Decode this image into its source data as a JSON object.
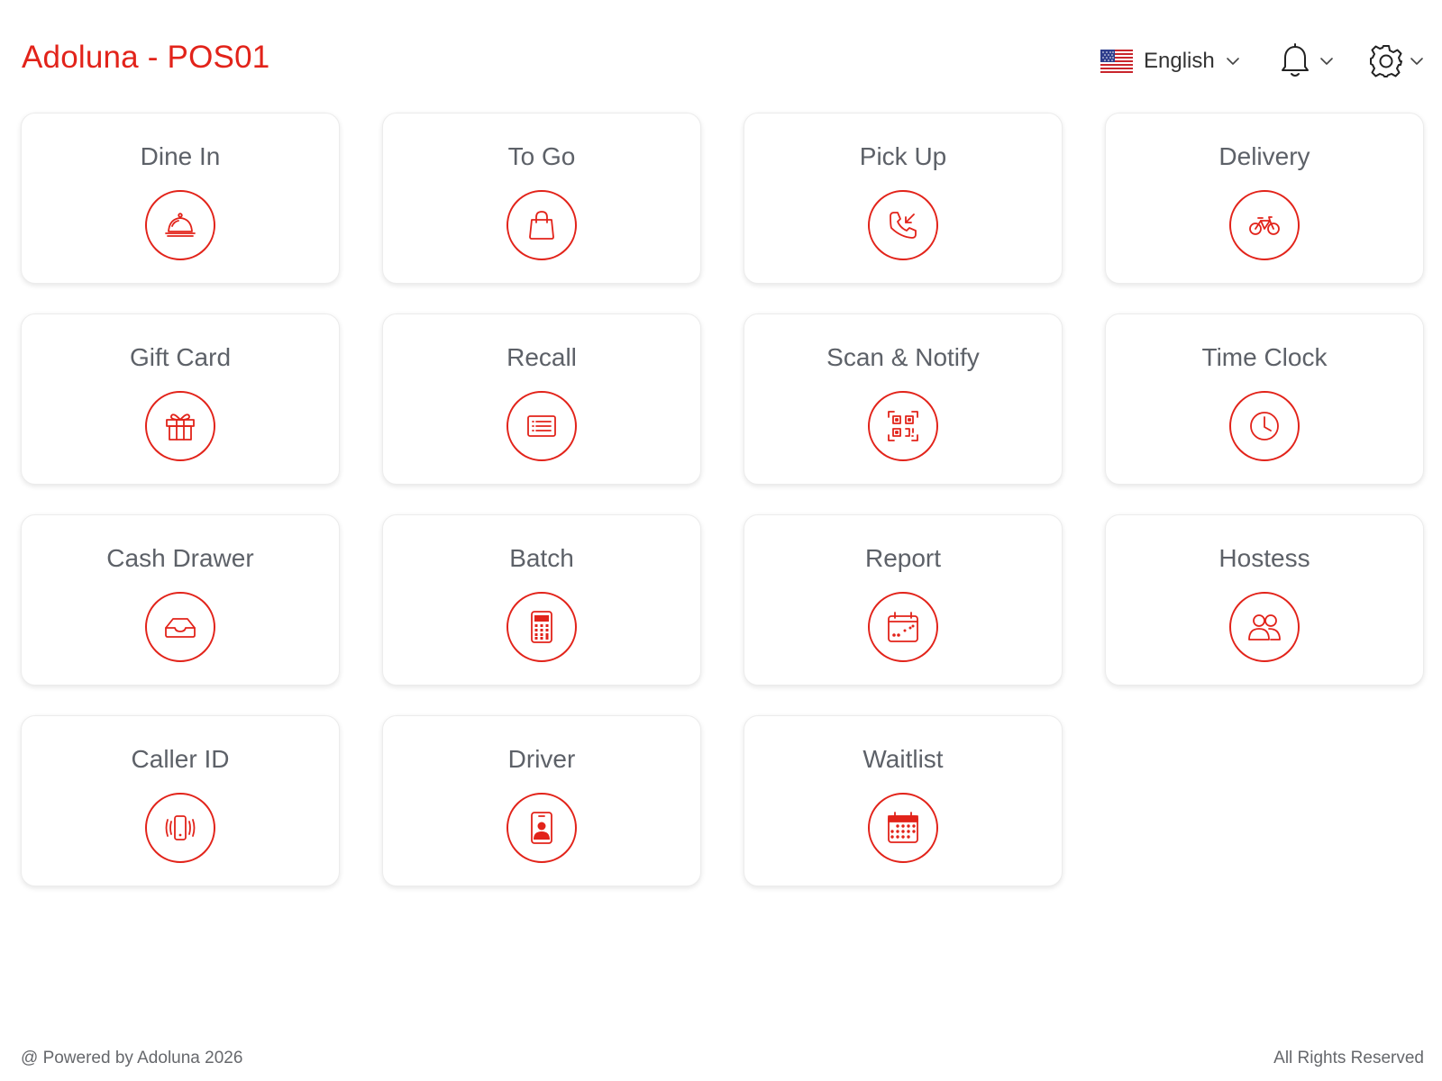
{
  "header": {
    "title": "Adoluna - POS01",
    "language": {
      "label": "English",
      "flag": "us-flag-icon"
    },
    "notifications": {
      "icon": "bell-icon"
    },
    "settings": {
      "icon": "gear-icon"
    }
  },
  "tiles": [
    {
      "label": "Dine In",
      "icon": "cloche-icon"
    },
    {
      "label": "To Go",
      "icon": "shopping-bag-icon"
    },
    {
      "label": "Pick Up",
      "icon": "incoming-call-icon"
    },
    {
      "label": "Delivery",
      "icon": "bicycle-icon"
    },
    {
      "label": "Gift Card",
      "icon": "gift-icon"
    },
    {
      "label": "Recall",
      "icon": "list-receipt-icon"
    },
    {
      "label": "Scan & Notify",
      "icon": "qr-code-icon"
    },
    {
      "label": "Time Clock",
      "icon": "clock-icon"
    },
    {
      "label": "Cash Drawer",
      "icon": "tray-icon"
    },
    {
      "label": "Batch",
      "icon": "calculator-icon"
    },
    {
      "label": "Report",
      "icon": "calendar-report-icon"
    },
    {
      "label": "Hostess",
      "icon": "people-icon"
    },
    {
      "label": "Caller ID",
      "icon": "vibrating-phone-icon"
    },
    {
      "label": "Driver",
      "icon": "id-badge-icon"
    },
    {
      "label": "Waitlist",
      "icon": "calendar-grid-icon"
    }
  ],
  "footer": {
    "left": "@ Powered by Adoluna 2026",
    "right": "All Rights Reserved"
  },
  "colors": {
    "accent": "#e2231a",
    "label": "#5d6168",
    "footer": "#66686c"
  }
}
